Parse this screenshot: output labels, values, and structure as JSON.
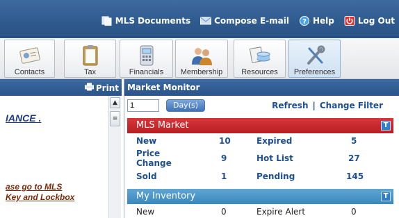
{
  "topbar": {
    "links": [
      {
        "label": "MLS Documents",
        "icon": "documents-icon"
      },
      {
        "label": "Compose E-mail",
        "icon": "envelope-icon"
      },
      {
        "label": "Help",
        "icon": "help-icon"
      },
      {
        "label": "Log Out",
        "icon": "power-icon"
      }
    ]
  },
  "toolbar": {
    "items": [
      {
        "label": "Contacts",
        "icon": "contacts-card-icon"
      },
      {
        "label": "Tax",
        "icon": "clipboard-icon"
      },
      {
        "label": "Financials",
        "icon": "calculator-icon"
      },
      {
        "label": "Membership",
        "icon": "people-icon"
      },
      {
        "label": "Resources",
        "icon": "resources-icon"
      },
      {
        "label": "Preferences",
        "icon": "tools-icon"
      }
    ]
  },
  "leftpanel": {
    "print_label": "Print",
    "text_1": "IANCE .",
    "text_2_line1": "ase go to MLS",
    "text_2_line2": "Key and Lockbox"
  },
  "monitor": {
    "title": "Market Monitor",
    "days_value": "1",
    "days_button": "Day(s)",
    "refresh_label": "Refresh",
    "separator": "|",
    "change_filter_label": "Change Filter",
    "mls_market": {
      "title": "MLS Market",
      "toggle": "T",
      "rows": [
        {
          "label1": "New",
          "value1": "10",
          "label2": "Expired",
          "value2": "5"
        },
        {
          "label1": "Price Change",
          "value1": "9",
          "label2": "Hot List",
          "value2": "27"
        },
        {
          "label1": "Sold",
          "value1": "1",
          "label2": "Pending",
          "value2": "145"
        }
      ]
    },
    "my_inventory": {
      "title": "My Inventory",
      "toggle": "T",
      "rows": [
        {
          "label1": "New",
          "value1": "0",
          "label2": "Expire Alert",
          "value2": "0"
        }
      ]
    }
  },
  "colors": {
    "topbar": "#2f5a8e",
    "link_blue": "#1d4f91",
    "mls_red": "#c8282c",
    "inventory_blue": "#4a96c8"
  }
}
